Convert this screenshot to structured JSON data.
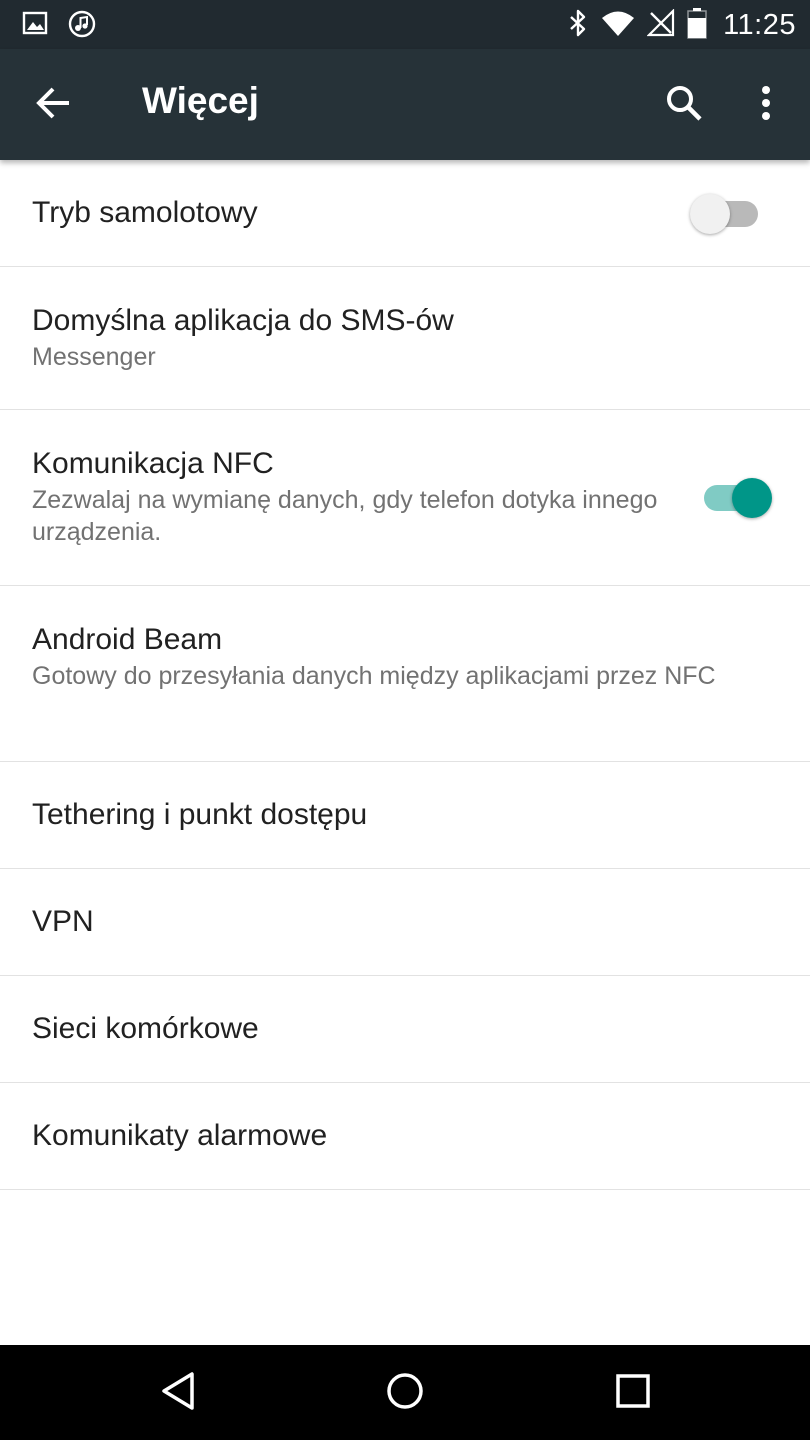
{
  "status_bar": {
    "time": "11:25",
    "left_icons": [
      "image-icon",
      "music-icon"
    ],
    "right_icons": [
      "bluetooth-icon",
      "wifi-icon",
      "no-signal-icon",
      "battery-icon"
    ]
  },
  "app_bar": {
    "title": "Więcej",
    "icons": [
      "back-arrow-icon",
      "search-icon",
      "more-vert-icon"
    ],
    "color": "#263238"
  },
  "settings": [
    {
      "title": "Tryb samolotowy",
      "summary": "",
      "switch": "off"
    },
    {
      "title": "Domyślna aplikacja do SMS-ów",
      "summary": "Messenger"
    },
    {
      "title": "Komunikacja NFC",
      "summary": "Zezwalaj na wymianę danych, gdy telefon dotyka innego urządzenia.",
      "switch": "on"
    },
    {
      "title": "Android Beam",
      "summary": "Gotowy do przesyłania danych między aplikacjami przez NFC"
    },
    {
      "title": "Tethering i punkt dostępu"
    },
    {
      "title": "VPN"
    },
    {
      "title": "Sieci komórkowe"
    },
    {
      "title": "Komunikaty alarmowe"
    }
  ],
  "accent_color": "#009688",
  "nav_bar": {
    "icons": [
      "back-triangle-icon",
      "home-circle-icon",
      "recents-square-icon"
    ]
  }
}
